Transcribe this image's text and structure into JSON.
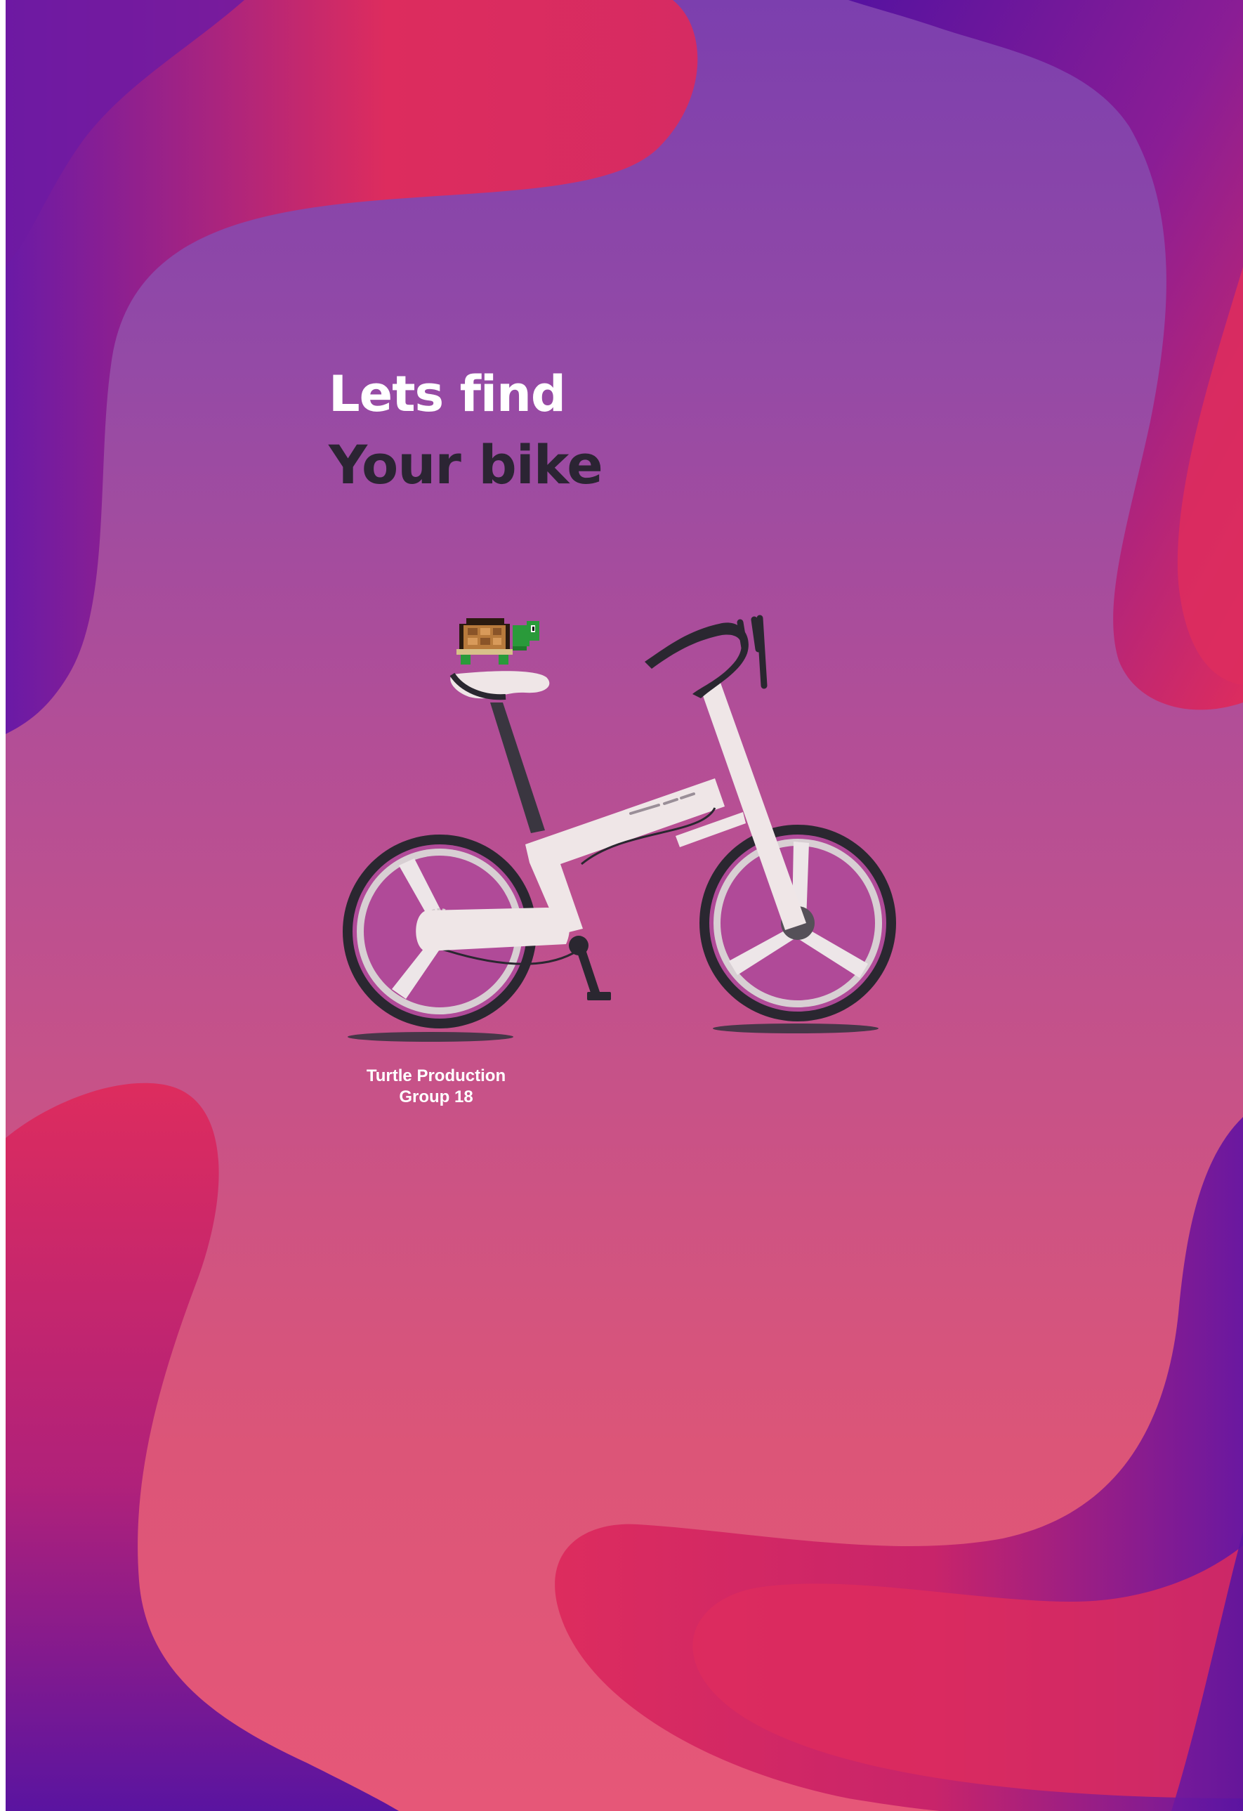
{
  "poster": {
    "headline_line1": "Lets find",
    "headline_line2": "Your bike",
    "credit_line1": "Turtle Production",
    "credit_line2": "Group 18"
  },
  "colors": {
    "background_top": "#7c3fae",
    "background_bottom": "#e65778",
    "blob_red": "#dd2c5e",
    "blob_purple": "#5a14a0",
    "headline_light": "#ffffff",
    "headline_dark": "#2b2433",
    "bike_frame": "#efe6e7",
    "tire": "#2a2730"
  },
  "illustration": {
    "subject": "bicycle-illustration",
    "rider": "pixel-turtle-icon"
  }
}
